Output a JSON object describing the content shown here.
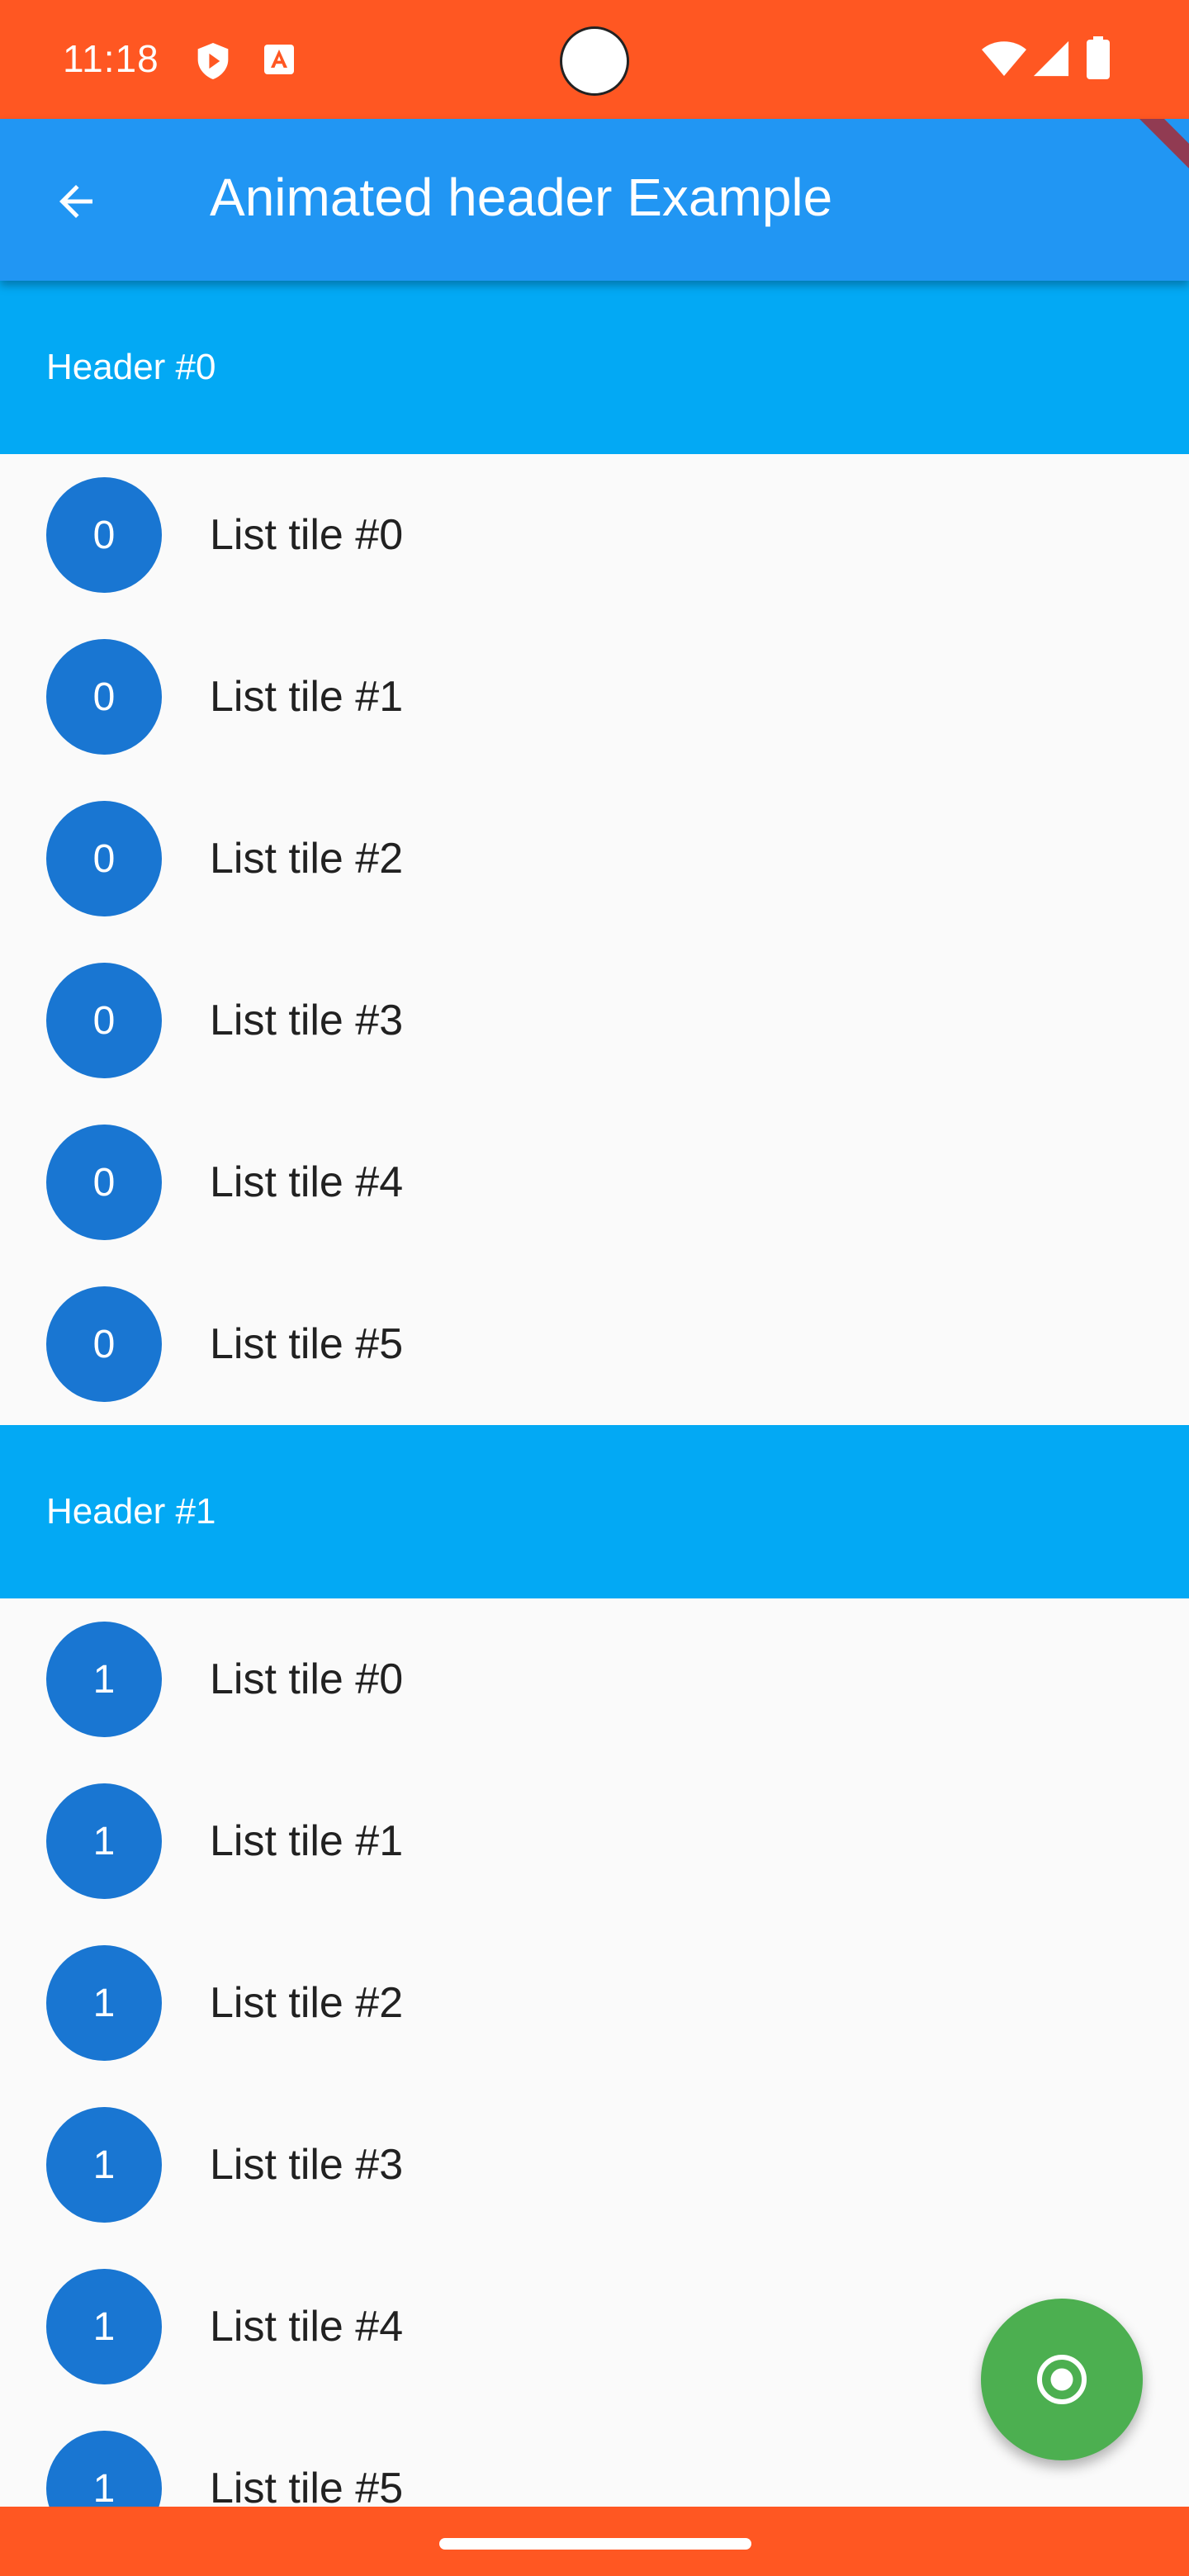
{
  "status_bar": {
    "time": "11:18",
    "icons": [
      "shield-play-icon",
      "a-text-icon",
      "wifi-icon",
      "signal-icon",
      "battery-icon"
    ]
  },
  "app_bar": {
    "title": "Animated header Example",
    "back_icon": "arrow-left-icon"
  },
  "colors": {
    "status_bar": "#ff5722",
    "app_bar": "#2196f3",
    "section_header": "#03a9f4",
    "avatar": "#1976d2",
    "fab": "#4caf50",
    "background": "#fafafa"
  },
  "sections": [
    {
      "header": "Header #0",
      "tiles": [
        {
          "avatar": "0",
          "title": "List tile #0"
        },
        {
          "avatar": "0",
          "title": "List tile #1"
        },
        {
          "avatar": "0",
          "title": "List tile #2"
        },
        {
          "avatar": "0",
          "title": "List tile #3"
        },
        {
          "avatar": "0",
          "title": "List tile #4"
        },
        {
          "avatar": "0",
          "title": "List tile #5"
        }
      ]
    },
    {
      "header": "Header #1",
      "tiles": [
        {
          "avatar": "1",
          "title": "List tile #0"
        },
        {
          "avatar": "1",
          "title": "List tile #1"
        },
        {
          "avatar": "1",
          "title": "List tile #2"
        },
        {
          "avatar": "1",
          "title": "List tile #3"
        },
        {
          "avatar": "1",
          "title": "List tile #4"
        },
        {
          "avatar": "1",
          "title": "List tile #5"
        }
      ]
    }
  ],
  "fab": {
    "icon": "radio-button-checked-icon"
  }
}
